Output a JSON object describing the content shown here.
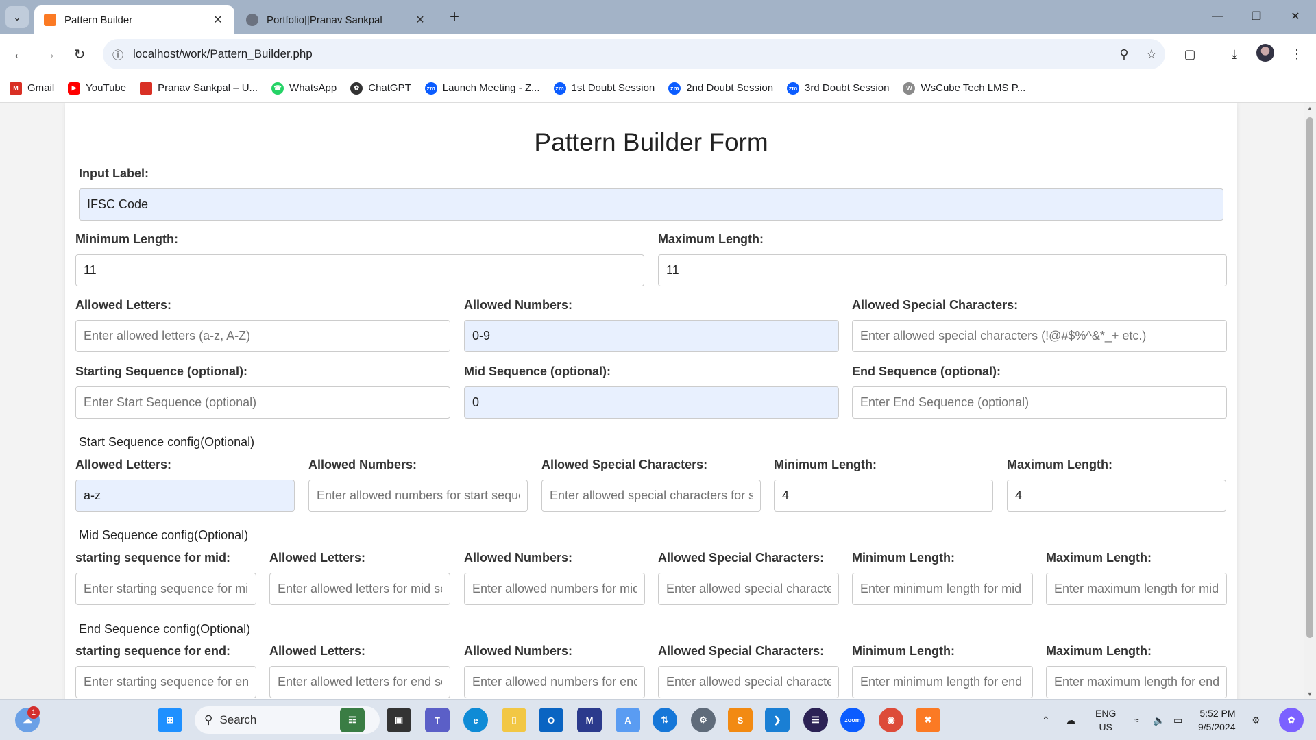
{
  "browser": {
    "tabs": [
      {
        "title": "Pattern Builder",
        "active": true
      },
      {
        "title": "Portfolio||Pranav Sankpal",
        "active": false
      }
    ],
    "url": "localhost/work/Pattern_Builder.php",
    "bookmarks": [
      {
        "label": "Gmail",
        "icon": "gmail-icon",
        "color": "#d93025"
      },
      {
        "label": "YouTube",
        "icon": "youtube-icon",
        "color": "#ff0000"
      },
      {
        "label": "Pranav Sankpal – U...",
        "icon": "bookmark-icon",
        "color": "#d93025"
      },
      {
        "label": "WhatsApp",
        "icon": "whatsapp-icon",
        "color": "#25d366"
      },
      {
        "label": "ChatGPT",
        "icon": "chatgpt-icon",
        "color": "#333333"
      },
      {
        "label": "Launch Meeting - Z...",
        "icon": "zoom-icon",
        "color": "#0b5cff"
      },
      {
        "label": "1st Doubt Session",
        "icon": "zoom-icon",
        "color": "#0b5cff"
      },
      {
        "label": "2nd Doubt Session",
        "icon": "zoom-icon",
        "color": "#0b5cff"
      },
      {
        "label": "3rd Doubt Session",
        "icon": "zoom-icon",
        "color": "#0b5cff"
      },
      {
        "label": "WsCube Tech LMS P...",
        "icon": "wscube-icon",
        "color": "#8a8a8a"
      }
    ]
  },
  "form": {
    "title": "Pattern Builder Form",
    "input_label": {
      "label": "Input Label:",
      "value": "IFSC Code"
    },
    "min_length": {
      "label": "Minimum Length:",
      "value": "11"
    },
    "max_length": {
      "label": "Maximum Length:",
      "value": "11"
    },
    "allowed_letters": {
      "label": "Allowed Letters:",
      "placeholder": "Enter allowed letters (a-z, A-Z)"
    },
    "allowed_numbers": {
      "label": "Allowed Numbers:",
      "value": "0-9"
    },
    "allowed_special": {
      "label": "Allowed Special Characters:",
      "placeholder": "Enter allowed special characters (!@#$%^&*_+ etc.)"
    },
    "start_seq": {
      "label": "Starting Sequence (optional):",
      "placeholder": "Enter Start Sequence (optional)"
    },
    "mid_seq": {
      "label": "Mid Sequence (optional):",
      "value": "0"
    },
    "end_seq": {
      "label": "End Sequence (optional):",
      "placeholder": "Enter End Sequence (optional)"
    },
    "start_config": {
      "heading": "Start Sequence config(Optional)",
      "letters": {
        "label": "Allowed Letters:",
        "value": "a-z"
      },
      "numbers": {
        "label": "Allowed Numbers:",
        "placeholder": "Enter allowed numbers for start sequence"
      },
      "special": {
        "label": "Allowed Special Characters:",
        "placeholder": "Enter allowed special characters for start sequence"
      },
      "min": {
        "label": "Minimum Length:",
        "value": "4"
      },
      "max": {
        "label": "Maximum Length:",
        "value": "4"
      }
    },
    "mid_config": {
      "heading": "Mid Sequence config(Optional)",
      "start": {
        "label": "starting sequence for mid:",
        "placeholder": "Enter starting sequence for mid sequence"
      },
      "letters": {
        "label": "Allowed Letters:",
        "placeholder": "Enter allowed letters for mid sequence"
      },
      "numbers": {
        "label": "Allowed Numbers:",
        "placeholder": "Enter allowed numbers for mid sequence"
      },
      "special": {
        "label": "Allowed Special Characters:",
        "placeholder": "Enter allowed special characters for mid sequence"
      },
      "min": {
        "label": "Minimum Length:",
        "placeholder": "Enter minimum length for mid sequence"
      },
      "max": {
        "label": "Maximum Length:",
        "placeholder": "Enter maximum length for mid sequence"
      }
    },
    "end_config": {
      "heading": "End Sequence config(Optional)",
      "start": {
        "label": "starting sequence for end:",
        "placeholder": "Enter starting sequence for end sequence"
      },
      "letters": {
        "label": "Allowed Letters:",
        "placeholder": "Enter allowed letters for end sequence"
      },
      "numbers": {
        "label": "Allowed Numbers:",
        "placeholder": "Enter allowed numbers for end sequence"
      },
      "special": {
        "label": "Allowed Special Characters:",
        "placeholder": "Enter allowed special characters for end sequence"
      },
      "min": {
        "label": "Minimum Length:",
        "placeholder": "Enter minimum length for end sequence"
      },
      "max": {
        "label": "Maximum Length:",
        "placeholder": "Enter maximum length for end sequence"
      }
    }
  },
  "taskbar": {
    "search_label": "Search",
    "weather_badge": "1",
    "language": "ENG",
    "region": "US",
    "time": "5:52 PM",
    "date": "9/5/2024"
  },
  "colors": {
    "autofill_bg": "#e8f0fe",
    "tabstrip_bg": "#a3b3c7",
    "xampp_orange": "#fb7a24"
  }
}
